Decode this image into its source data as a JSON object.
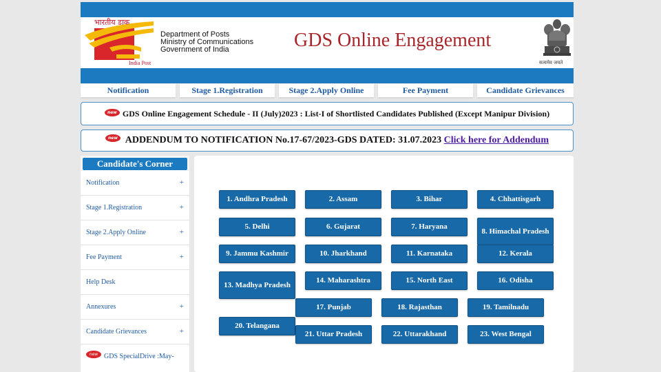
{
  "header": {
    "logo_hindi": "भारतीय डाक",
    "logo_caption": "India Post",
    "dept_lines": [
      "Department of Posts",
      "Ministry of Communications",
      "Government of India"
    ],
    "title": "GDS Online Engagement",
    "emblem_motto": "सत्यमेव जयते"
  },
  "nav": [
    "Notification",
    "Stage 1.Registration",
    "Stage 2.Apply Online",
    "Fee Payment",
    "Candidate Grievances"
  ],
  "notices": {
    "new_label": "new",
    "schedule": "GDS Online Engagement Schedule - II (July)2023 : List-I of Shortlisted Candidates Published (Except Manipur Division)",
    "addendum_text": "ADDENDUM TO NOTIFICATION No.17-67/2023-GDS DATED: 31.07.2023",
    "addendum_link": "Click here for Addendum"
  },
  "sidebar": {
    "title": "Candidate's Corner",
    "items": [
      {
        "label": "Notification",
        "plus": "+"
      },
      {
        "label": "Stage 1.Registration",
        "plus": "+"
      },
      {
        "label": "Stage 2.Apply Online",
        "plus": "+"
      },
      {
        "label": "Fee Payment",
        "plus": "+"
      },
      {
        "label": "Help Desk",
        "plus": ""
      },
      {
        "label": "Annexures",
        "plus": "+"
      },
      {
        "label": "Candidate Grievances",
        "plus": "+"
      },
      {
        "label": "GDS SpecialDrive :May-",
        "plus": ""
      }
    ]
  },
  "states": [
    "1. Andhra Pradesh",
    "2. Assam",
    "3. Bihar",
    "4. Chhattisgarh",
    "5. Delhi",
    "6. Gujarat",
    "7. Haryana",
    "8. Himachal Pradesh",
    "9. Jammu Kashmir",
    "10. Jharkhand",
    "11. Karnataka",
    "12. Kerala",
    "13. Madhya Pradesh",
    "14. Maharashtra",
    "15. North East",
    "16. Odisha",
    "17. Punjab",
    "18. Rajasthan",
    "19. Tamilnadu",
    "20. Telangana",
    "21. Uttar Pradesh",
    "22. Uttarakhand",
    "23. West Bengal"
  ],
  "colors": {
    "brand_blue": "#1c7ac0",
    "button_blue": "#1869a8",
    "title_red": "#a8262b",
    "link_purple": "#4b1ba1"
  }
}
